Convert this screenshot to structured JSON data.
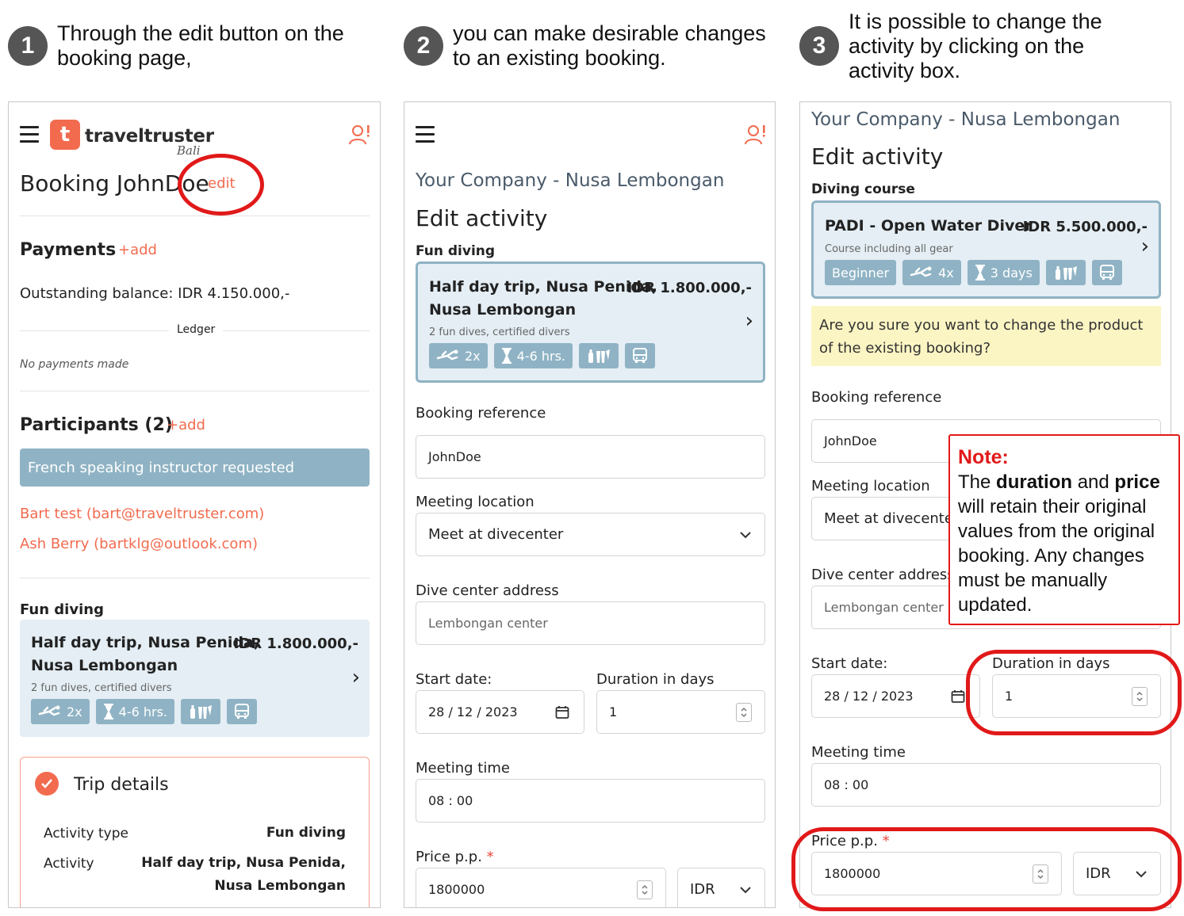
{
  "steps": [
    {
      "number": "1",
      "text": "Through the edit button on the booking page,"
    },
    {
      "number": "2",
      "text": "you can make desirable changes to an existing booking."
    },
    {
      "number": "3",
      "text": "It is possible to change the activity by clicking on the activity box."
    }
  ],
  "panel1": {
    "logo_text": "traveltruster",
    "logo_sub": "Bali",
    "logo_glyph": "t",
    "booking_title": "Booking JohnDoe",
    "edit_link": "edit",
    "payments": {
      "heading": "Payments",
      "add": "+add",
      "outstanding": "Outstanding balance: IDR 4.150.000,-",
      "ledger": "Ledger",
      "empty": "No payments made"
    },
    "participants": {
      "heading": "Participants (2)",
      "add": "+add",
      "banner": "French speaking instructor requested",
      "people": [
        "Bart test (bart@traveltruster.com)",
        "Ash Berry (bartklg@outlook.com)"
      ]
    },
    "activity": {
      "category": "Fun diving",
      "name_line1": "Half day trip, Nusa Penida,",
      "name_line2": "Nusa Lembongan",
      "price": "IDR 1.800.000,-",
      "desc": "2 fun dives, certified divers",
      "badges": {
        "dives": "2x",
        "duration": "4-6 hrs."
      }
    },
    "trip": {
      "title": "Trip details",
      "activity_type_key": "Activity type",
      "activity_type_val": "Fun diving",
      "activity_key": "Activity",
      "activity_val_line1": "Half day trip, Nusa Penida,",
      "activity_val_line2": "Nusa Lembongan"
    }
  },
  "panel2": {
    "company": "Your Company - Nusa Lembongan",
    "heading": "Edit activity",
    "category": "Fun diving",
    "activity": {
      "name_line1": "Half day trip, Nusa Penida,",
      "name_line2": "Nusa Lembongan",
      "price": "IDR 1.800.000,-",
      "desc": "2 fun dives, certified divers",
      "badges": {
        "dives": "2x",
        "duration": "4-6 hrs."
      }
    },
    "booking_reference": {
      "label": "Booking reference",
      "value": "JohnDoe"
    },
    "meeting_location": {
      "label": "Meeting location",
      "value": "Meet at divecenter"
    },
    "dive_center": {
      "label": "Dive center address",
      "value": "Lembongan center"
    },
    "start_date": {
      "label": "Start date:",
      "value": "28 / 12 / 2023"
    },
    "duration": {
      "label": "Duration in days",
      "value": "1"
    },
    "meeting_time": {
      "label": "Meeting time",
      "value": "08 : 00"
    },
    "price": {
      "label": "Price p.p.",
      "required": "*",
      "value": "1800000",
      "currency": "IDR"
    }
  },
  "panel3": {
    "company": "Your Company - Nusa Lembongan",
    "heading": "Edit activity",
    "category": "Diving course",
    "activity": {
      "name": "PADI - Open Water Diver",
      "price": "IDR 5.500.000,-",
      "desc": "Course including all gear",
      "badges": {
        "level": "Beginner",
        "dives": "4x",
        "duration": "3 days"
      }
    },
    "warning": "Are you sure you want to change the product of the existing booking?",
    "booking_reference": {
      "label": "Booking reference",
      "value": "JohnDoe"
    },
    "meeting_location": {
      "label": "Meeting location",
      "value": "Meet at divecenter"
    },
    "dive_center": {
      "label": "Dive center address",
      "value": "Lembongan center"
    },
    "start_date": {
      "label": "Start date:",
      "value": "28 / 12 / 2023"
    },
    "duration": {
      "label": "Duration in days",
      "value": "1"
    },
    "meeting_time": {
      "label": "Meeting time",
      "value": "08 : 00"
    },
    "price": {
      "label": "Price p.p.",
      "required": "*",
      "value": "1800000",
      "currency": "IDR"
    }
  },
  "note": {
    "title": "Note:",
    "part1": "The ",
    "bold1": "duration",
    "part2": " and ",
    "bold2": "price",
    "part3": " will retain their original values from the original booking. Any changes must be manually updated."
  },
  "colors": {
    "accent": "#f26b4f",
    "badge": "#8fb3c4",
    "card_bg": "#e4eef4",
    "highlight": "#e11919",
    "warning_bg": "#fbf5c4"
  },
  "icons": [
    "menu-icon",
    "user-alert-icon",
    "diver-icon",
    "hourglass-icon",
    "gear-icon",
    "bus-icon",
    "chevron-right-icon",
    "chevron-down-icon",
    "calendar-icon",
    "spinner-icon",
    "check-icon"
  ]
}
